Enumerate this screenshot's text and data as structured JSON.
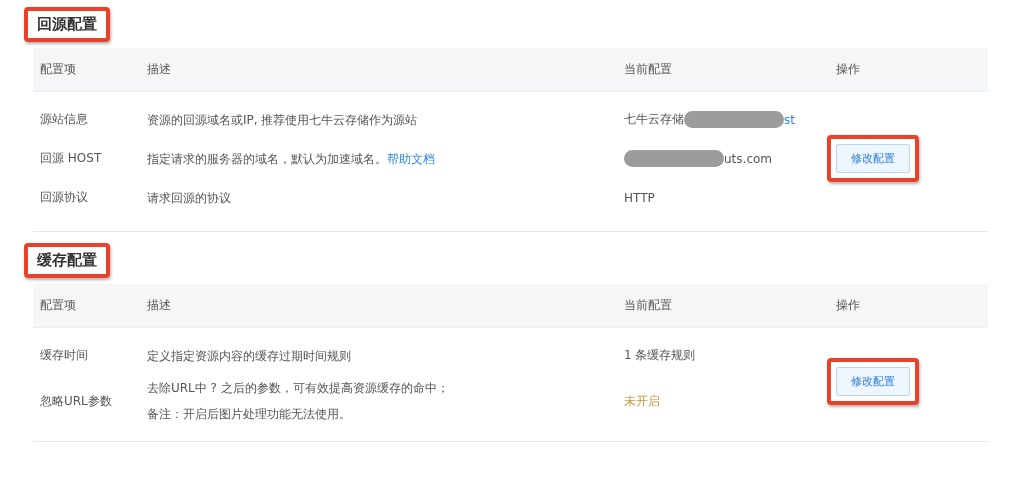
{
  "sections": [
    {
      "title": "回源配置",
      "highlighted": true,
      "columns": [
        "配置项",
        "描述",
        "当前配置",
        "操作"
      ],
      "rows": [
        {
          "item": "源站信息",
          "description": [
            "资源的回源域名或IP, 推荐使用七牛云存储作为源站"
          ],
          "value": [
            {
              "kind": "text",
              "text": "七牛云存储"
            },
            {
              "kind": "redacted"
            },
            {
              "kind": "link",
              "text": "st"
            }
          ]
        },
        {
          "item": "回源 HOST",
          "description": [
            "指定请求的服务器的域名，默认为加速域名。"
          ],
          "link": "帮助文档",
          "value": [
            {
              "kind": "redacted"
            },
            {
              "kind": "text",
              "text": "uts.com"
            }
          ]
        },
        {
          "item": "回源协议",
          "description": [
            "请求回源的协议"
          ],
          "value": [
            {
              "kind": "text",
              "text": "HTTP"
            }
          ]
        }
      ],
      "button": {
        "label": "修改配置",
        "highlighted": true
      }
    },
    {
      "title": "缓存配置",
      "highlighted": true,
      "columns": [
        "配置项",
        "描述",
        "当前配置",
        "操作"
      ],
      "rows": [
        {
          "item": "缓存时间",
          "description": [
            "定义指定资源内容的缓存过期时间规则"
          ],
          "value": [
            {
              "kind": "text",
              "text": "1 条缓存规则"
            }
          ]
        },
        {
          "item": "忽略URL参数",
          "description": [
            "去除URL中 ? 之后的参数，可有效提高资源缓存的命中；",
            "备注：开启后图片处理功能无法使用。"
          ],
          "value": [
            {
              "kind": "warning",
              "text": "未开启"
            }
          ]
        }
      ],
      "button": {
        "label": "修改配置",
        "highlighted": true
      }
    }
  ]
}
